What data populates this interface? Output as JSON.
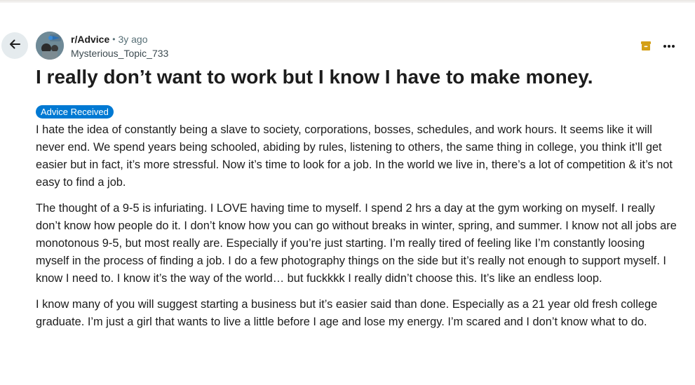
{
  "header": {
    "back_icon": "arrow-left-icon",
    "subreddit": "r/Advice",
    "separator": "•",
    "age": "3y ago",
    "username": "Mysterious_Topic_733",
    "archive_icon": "archive-icon",
    "archive_color": "#d4a017",
    "more_icon": "ellipsis-icon"
  },
  "post": {
    "title": "I really don’t want to work but I know I have to make money.",
    "flair": "Advice Received",
    "flair_color": "#0079d3",
    "paragraphs": [
      "I hate the idea of constantly being a slave to society, corporations, bosses, schedules, and work hours. It seems like it will never end. We spend years being schooled, abiding by rules, listening to others, the same thing in college, you think it’ll get easier but in fact, it’s more stressful. Now it’s time to look for a job. In the world we live in, there’s a lot of competition & it’s not easy to find a job.",
      "The thought of a 9-5 is infuriating. I LOVE having time to myself. I spend 2 hrs a day at the gym working on myself. I really don’t know how people do it. I don’t know how you can go without breaks in winter, spring, and summer. I know not all jobs are monotonous 9-5, but most really are. Especially if you’re just starting. I’m really tired of feeling like I’m constantly loosing myself in the process of finding a job. I do a few photography things on the side but it’s really not enough to support myself. I know I need to. I know it’s the way of the world… but fuckkkk I really didn’t choose this. It’s like an endless loop.",
      "I know many of you will suggest starting a business but it’s easier said than done. Especially as a 21 year old fresh college graduate. I’m just a girl that wants to live a little before I age and lose my energy. I’m scared and I don’t know what to do."
    ]
  }
}
